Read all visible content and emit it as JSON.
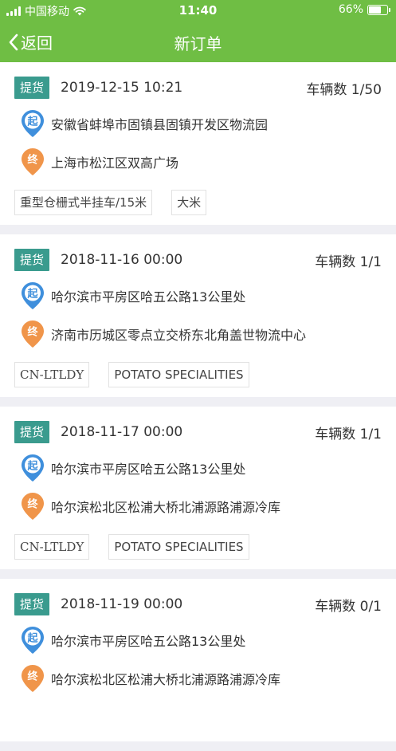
{
  "status_bar": {
    "carrier": "中国移动",
    "time": "11:40",
    "battery": "66%",
    "battery_level": 0.66
  },
  "navbar": {
    "back_label": "返回",
    "title": "新订单"
  },
  "orders": [
    {
      "tag": "提货",
      "date": "2019-12-15 10:21",
      "count": "车辆数 1/50",
      "start_badge": "起",
      "start": "安徽省蚌埠市固镇县固镇开发区物流园",
      "end_badge": "终",
      "end": "上海市松江区双高广场",
      "chips": [
        "重型仓栅式半挂车/15米",
        "大米"
      ]
    },
    {
      "tag": "提货",
      "date": "2018-11-16 00:00",
      "count": "车辆数 1/1",
      "start_badge": "起",
      "start": "哈尔滨市平房区哈五公路13公里处",
      "end_badge": "终",
      "end": "济南市历城区零点立交桥东北角盖世物流中心",
      "chips": [
        "CN-LTLDY",
        "POTATO SPECIALITIES"
      ]
    },
    {
      "tag": "提货",
      "date": "2018-11-17 00:00",
      "count": "车辆数 1/1",
      "start_badge": "起",
      "start": "哈尔滨市平房区哈五公路13公里处",
      "end_badge": "终",
      "end": "哈尔滨松北区松浦大桥北浦源路浦源冷库",
      "chips": [
        "CN-LTLDY",
        "POTATO SPECIALITIES"
      ]
    },
    {
      "tag": "提货",
      "date": "2018-11-19 00:00",
      "count": "车辆数 0/1",
      "start_badge": "起",
      "start": "哈尔滨市平房区哈五公路13公里处",
      "end_badge": "终",
      "end": "哈尔滨松北区松浦大桥北浦源路浦源冷库",
      "chips": []
    }
  ],
  "colors": {
    "brand_green": "#6fbe44",
    "tag_teal": "#3a9b8e",
    "start_pin": "#3f8fdc",
    "end_pin": "#f0954a"
  }
}
